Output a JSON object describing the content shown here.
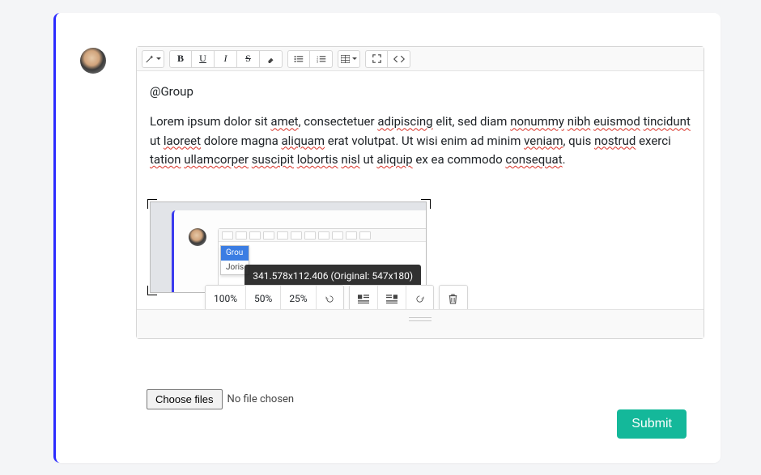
{
  "toolbar": {
    "bold": "B",
    "underline": "U",
    "italic": "I",
    "strike": "S"
  },
  "content": {
    "mention": "@Group",
    "text_parts": {
      "p1": "Lorem ipsum dolor sit ",
      "w_amet": "amet",
      "p2": ", consectetuer ",
      "w_adipiscing": "adipiscing",
      "p3": " elit, sed diam ",
      "w_nonummy": "nonummy",
      "sp1": " ",
      "w_nibh": "nibh",
      "sp2": " ",
      "w_euismod": "euismod",
      "sp3": " ",
      "w_tincidunt": "tincidunt",
      "p4": " ut ",
      "w_laoreet": "laoreet",
      "p5": " dolore magna ",
      "w_aliquam": "aliquam",
      "p6": " erat volutpat. Ut wisi enim ad minim ",
      "w_veniam": "veniam",
      "p7": ", quis ",
      "w_nostrud": "nostrud",
      "p8": " exerci ",
      "w_tation": "tation",
      "sp4": " ",
      "w_ullamcorper": "ullamcorper",
      "sp5": " ",
      "w_suscipit": "suscipit",
      "sp6": " ",
      "w_lobortis": "lobortis",
      "sp7": " ",
      "w_nisl": "nisl",
      "p9": " ut ",
      "w_aliquip": "aliquip",
      "p10": " ex ea commodo ",
      "w_consequat": "consequat",
      "p11": "."
    }
  },
  "embedded": {
    "tooltip": "341.578x112.406 (Original: 547x180)",
    "inner_at": "@",
    "dd_active": "Grou",
    "dd_item": "Joris"
  },
  "image_toolbar": {
    "size100": "100%",
    "size50": "50%",
    "size25": "25%"
  },
  "file": {
    "button": "Choose files",
    "status": "No file chosen"
  },
  "submit": "Submit",
  "colors": {
    "accent_blue": "#2b2bff",
    "submit_green": "#14b89a"
  }
}
